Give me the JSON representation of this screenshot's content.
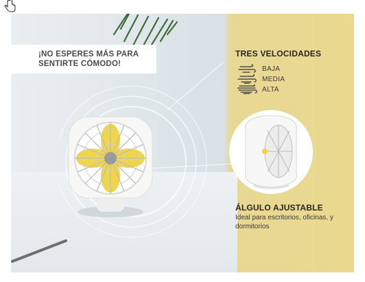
{
  "banner": {
    "headline": "¡NO ESPERES MÁS PARA SENTIRTE CÓMODO!",
    "speeds": {
      "title": "TRES VELOCIDADES",
      "items": [
        {
          "label": "BAJA"
        },
        {
          "label": "MEDIA"
        },
        {
          "label": "ALTA"
        }
      ]
    },
    "adjustable": {
      "title": "ÁLGULO AJUSTABLE",
      "description": "Ideal para escritorios, oficinas, y dormitorios"
    }
  },
  "colors": {
    "yellow_panel": "#ead98f",
    "fan_blade": "#f0d44a",
    "fan_body": "#f7f7f5"
  },
  "icons": [
    "hand-cursor-icon",
    "wind-icon"
  ]
}
